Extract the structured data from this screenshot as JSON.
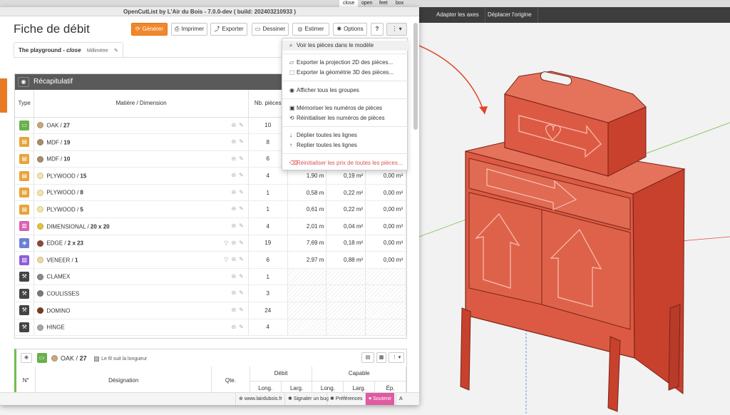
{
  "system_bar": {
    "items": [
      "close",
      "open",
      "feet",
      "box"
    ]
  },
  "sketchup_toolbar": {
    "items": [
      "Adapter les axes",
      "Déplacer l'origine"
    ]
  },
  "window": {
    "title": "OpenCutList by L'Air du Bois - 7.0.0-dev ( build: 202403210933 )"
  },
  "page": {
    "title": "Fiche de débit"
  },
  "toolbar": {
    "generate": "Générer",
    "print": "Imprimer",
    "export": "Exporter",
    "draw": "Dessiner",
    "estimate": "Estimer",
    "options": "Options",
    "help": "?",
    "more": "⋮"
  },
  "tab": {
    "model": "The playground",
    "sep": " - ",
    "state": "close",
    "unit": "Millimètre"
  },
  "summary": {
    "title": "Récapitulatif",
    "headers": {
      "type": "Type",
      "material": "Matière / Dimension",
      "count": "Nb. pièces"
    },
    "rows": [
      {
        "name": "OAK",
        "dim": "27",
        "count": "10",
        "length": "",
        "area": "",
        "volume": "",
        "type_color": "#6ab04c",
        "dot": "#c9a77c"
      },
      {
        "name": "MDF",
        "dim": "19",
        "count": "8",
        "length": "",
        "area": "",
        "volume": "",
        "type_color": "#e8a33a",
        "dot": "#a88d6b"
      },
      {
        "name": "MDF",
        "dim": "10",
        "count": "6",
        "length": "",
        "area": "",
        "volume": "",
        "type_color": "#e8a33a",
        "dot": "#a88d6b"
      },
      {
        "name": "PLYWOOD",
        "dim": "15",
        "count": "4",
        "length": "1,90 m",
        "area": "0,19 m²",
        "volume": "0,00 m³",
        "type_color": "#e8a33a",
        "dot": "#f3e6a6"
      },
      {
        "name": "PLYWOOD",
        "dim": "8",
        "count": "1",
        "length": "0,58 m",
        "area": "0,22 m²",
        "volume": "0,00 m³",
        "type_color": "#e8a33a",
        "dot": "#f3e6a6"
      },
      {
        "name": "PLYWOOD",
        "dim": "5",
        "count": "1",
        "length": "0,61 m",
        "area": "0,22 m²",
        "volume": "0,00 m³",
        "type_color": "#e8a33a",
        "dot": "#f3e6a6"
      },
      {
        "name": "DIMENSIONAL",
        "dim": "20 x 20",
        "count": "4",
        "length": "2,01 m",
        "area": "0,04 m²",
        "volume": "0,00 m³",
        "type_color": "#d95fb3",
        "dot": "#e3c23d"
      },
      {
        "name": "EDGE",
        "dim": "2 x 23",
        "count": "19",
        "length": "7,69 m",
        "area": "0,18 m²",
        "volume": "0,00 m³",
        "type_color": "#6b7fd6",
        "dot": "#8c4a3a"
      },
      {
        "name": "VENEER",
        "dim": "1",
        "count": "6",
        "length": "2,97 m",
        "area": "0,88 m²",
        "volume": "0,00 m³",
        "type_color": "#8e5ed6",
        "dot": "#f0d6a0"
      },
      {
        "name": "CLAMEX",
        "dim": "",
        "count": "1",
        "length": "",
        "area": "",
        "volume": "",
        "type_color": "#444444",
        "dot": "#8a8a8a"
      },
      {
        "name": "COULISSES",
        "dim": "",
        "count": "3",
        "length": "",
        "area": "",
        "volume": "",
        "type_color": "#444444",
        "dot": "#7a7a7a"
      },
      {
        "name": "DOMINO",
        "dim": "",
        "count": "24",
        "length": "",
        "area": "",
        "volume": "",
        "type_color": "#444444",
        "dot": "#7d3a1e"
      },
      {
        "name": "HINGE",
        "dim": "",
        "count": "4",
        "length": "",
        "area": "",
        "volume": "",
        "type_color": "#444444",
        "dot": "#a8a8a8"
      }
    ]
  },
  "group": {
    "material": "OAK",
    "dim": "27",
    "grain_label": "Le fil suit la longueur",
    "headers": {
      "num": "N°",
      "designation": "Désignation",
      "qty": "Qte.",
      "debit": "Débit",
      "capable": "Capable",
      "long": "Long.",
      "larg": "Larg.",
      "ep": "Ép."
    }
  },
  "footer": {
    "site": "www.lairdubois.fr",
    "bug": "Signaler un bug",
    "prefs": "Préférences",
    "support": "Soutenir",
    "about": "A propos"
  },
  "menu": {
    "items": [
      "Voir les pièces dans le modèle",
      "Exporter la projection 2D des pièces...",
      "Exporter la géométrie 3D des pièces...",
      "Afficher tous les groupes",
      "Mémoriser les numéros de pièces",
      "Réinitialiser les numéros de pièces",
      "Déplier toutes les lignes",
      "Replier toutes les lignes",
      "Réinitialiser les prix de toutes les pièces..."
    ]
  }
}
